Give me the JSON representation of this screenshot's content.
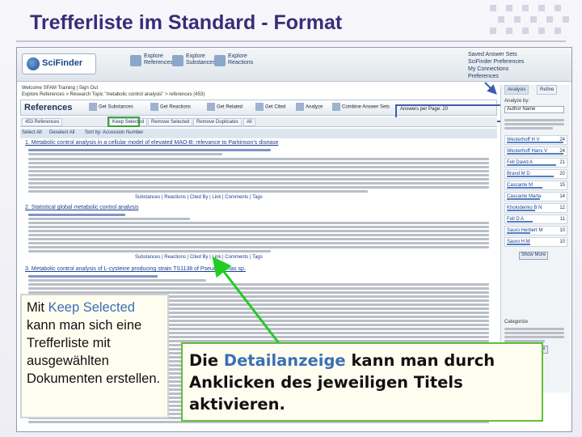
{
  "slide": {
    "title": "Trefferliste im Standard - Format"
  },
  "app": {
    "logo_text": "SciFinder",
    "header_buttons": [
      {
        "line1": "Explore",
        "line2": "References"
      },
      {
        "line1": "Explore",
        "line2": "Substances"
      },
      {
        "line1": "Explore",
        "line2": "Reactions"
      }
    ],
    "user_links": [
      "Saved Answer Sets",
      "SciFinder Preferences",
      "My Connections",
      "Preferences"
    ],
    "breadcrumbs_line1": "Welcome SFAM Training | Sign Out",
    "breadcrumbs_line2": "Explore References > Research Topic \"metabolic control analysis\" > references (453)",
    "references_label": "References",
    "toolbar_items": [
      "Get Substances",
      "Get Reactions",
      "Get Related",
      "Get Cited",
      "Analyze",
      "Combine Answer Sets"
    ],
    "tabs": [
      "453 References",
      "Keep Selected",
      "Remove Selected",
      "Remove Duplicates",
      "All"
    ],
    "select_row": [
      "Select All",
      "Deselect All",
      "Sort by: Accession Number"
    ],
    "per_page": "Answers per Page: 20",
    "records": [
      {
        "title": "1. Metabolic control analysis in a cellular model of elevated MAO-B: relevance to Parkinson's disease"
      },
      {
        "title": "2. Statistical global metabolic control analysis"
      },
      {
        "title": "3. Metabolic control analysis of L-cysteine producing strain TS1138 of Pseudomonas sp."
      }
    ],
    "record_actions": "Substances | Reactions | Cited By | Link | Comments | Tags",
    "sidebar": {
      "tab_analysis": "Analysis",
      "tab_refine": "Refine",
      "analyze_by_label": "Analyze by:",
      "analyze_by_value": "Author Name",
      "facets": [
        {
          "label": "Westerhoff H V",
          "count": "24"
        },
        {
          "label": "Westerhoff Hans V",
          "count": "24"
        },
        {
          "label": "Fell David A",
          "count": "21"
        },
        {
          "label": "Brand M D",
          "count": "20"
        },
        {
          "label": "Cascante M",
          "count": "15"
        },
        {
          "label": "Cascante Marta",
          "count": "14"
        },
        {
          "label": "Kholodenko B N",
          "count": "12"
        },
        {
          "label": "Fell D A",
          "count": "11"
        },
        {
          "label": "Sauro Herbert M",
          "count": "10"
        },
        {
          "label": "Sauro H M",
          "count": "10"
        }
      ],
      "show_more": "Show More",
      "categories_label": "Categorize",
      "categorize_button": "Categorize"
    }
  },
  "callouts": {
    "left_line1_pre": "Mit ",
    "left_highlight": "Keep Selected",
    "left_rest": "kann man sich eine Trefferliste mit ausgewählten Dokumenten erstellen.",
    "right_pre": "Die ",
    "right_highlight": "Detailanzeige",
    "right_rest": "kann man durch Anklicken des jeweiligen Titels aktivieren."
  },
  "colors": {
    "title": "#3a2c7a",
    "highlight_text": "#3a6fb6",
    "green_border": "#5fbf3f",
    "arrow": "#22cc22"
  }
}
